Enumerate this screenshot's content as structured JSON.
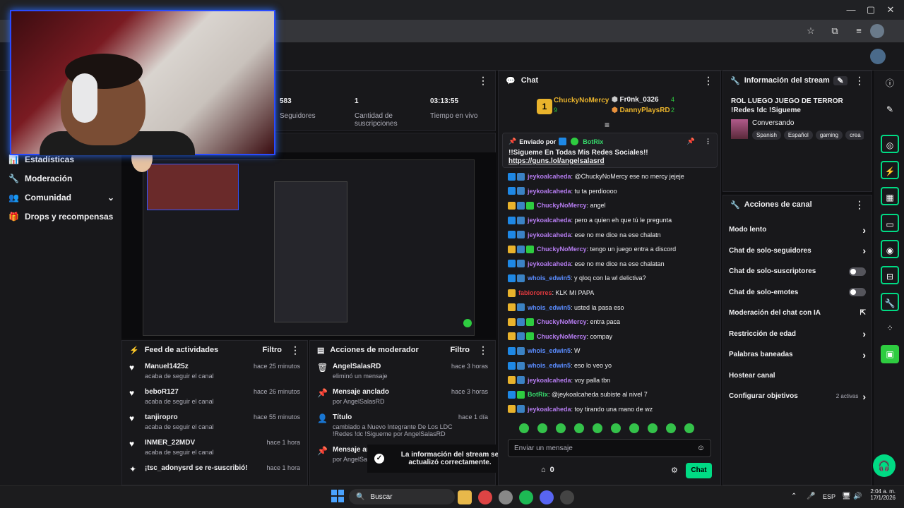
{
  "browser": {
    "extension_icons": [
      "star-icon",
      "puzzle-icon",
      "media-icon",
      "avatar"
    ]
  },
  "sidebar": {
    "items": [
      {
        "label": "Estadísticas"
      },
      {
        "label": "Moderación"
      },
      {
        "label": "Comunidad"
      },
      {
        "label": "Drops y recompensas"
      }
    ]
  },
  "stats": [
    {
      "value": "583",
      "label": "Seguidores"
    },
    {
      "value": "1",
      "label": "Cantidad de suscripciones"
    },
    {
      "value": "03:13:55",
      "label": "Tiempo en vivo"
    }
  ],
  "feed": {
    "title": "Feed de actividades",
    "filter_label": "Filtro",
    "items": [
      {
        "name": "Manuel1425z",
        "sub": "acaba de seguir el canal",
        "time": "hace 25 minutos"
      },
      {
        "name": "beboR127",
        "sub": "acaba de seguir el canal",
        "time": "hace 26 minutos"
      },
      {
        "name": "tanjiropro",
        "sub": "acaba de seguir el canal",
        "time": "hace 55 minutos"
      },
      {
        "name": "INMER_22MDV",
        "sub": "acaba de seguir el canal",
        "time": "hace 1 hora"
      },
      {
        "name": "¡tsc_adonysrd se re-suscribió!",
        "sub": "",
        "time": "hace 1 hora"
      }
    ]
  },
  "modactions": {
    "title": "Acciones de moderador",
    "filter_label": "Filtro",
    "items": [
      {
        "name": "AngelSalasRD",
        "sub": "eliminó un mensaje",
        "time": "hace 3 horas"
      },
      {
        "name": "Mensaje anclado",
        "sub": "por AngelSalasRD",
        "time": "hace 3 horas"
      },
      {
        "name": "Título",
        "sub": "cambiado a Nuevo Integrante De Los LDC !Redes !dc !Sigueme por AngelSalasRD",
        "time": "hace 1 día"
      },
      {
        "name": "Mensaje an",
        "sub": "por AngelSal",
        "time": ""
      }
    ]
  },
  "toast": {
    "text": "La información del stream se actualizó correctamente."
  },
  "chat": {
    "title": "Chat",
    "leaderboard": [
      {
        "name": "ChuckyNoMercy",
        "count": "9"
      },
      {
        "name": "Fr0nk_0326",
        "count": "4"
      },
      {
        "name": "DannyPlaysRD",
        "count": "2"
      }
    ],
    "pinned": {
      "sent_by_label": "Enviado por",
      "sender": "BotRix",
      "message": "!!Sigueme En Todas Mis Redes Sociales!!",
      "link": "https://guns.lol/angelsalasrd"
    },
    "messages": [
      {
        "user": "jeykoalcaheda",
        "color": "#b57cf0",
        "text": ": @ChuckyNoMercy ese no mercy jejeje",
        "badges": [
          "arrow",
          "grid"
        ]
      },
      {
        "user": "jeykoalcaheda",
        "color": "#b57cf0",
        "text": ": tu ta perdioooo",
        "badges": [
          "arrow",
          "grid"
        ]
      },
      {
        "user": "ChuckyNoMercy",
        "color": "#b57cf0",
        "text": ": angel",
        "badges": [
          "crown",
          "grid",
          "green"
        ]
      },
      {
        "user": "jeykoalcaheda",
        "color": "#b57cf0",
        "text": ": pero a quien eh que tú le pregunta",
        "badges": [
          "arrow",
          "grid"
        ]
      },
      {
        "user": "jeykoalcaheda",
        "color": "#b57cf0",
        "text": ": ese no me dice na ese chalatn",
        "badges": [
          "arrow",
          "grid"
        ]
      },
      {
        "user": "ChuckyNoMercy",
        "color": "#b57cf0",
        "text": ": tengo un juego entra a discord",
        "badges": [
          "crown",
          "grid",
          "green"
        ]
      },
      {
        "user": "jeykoalcaheda",
        "color": "#b57cf0",
        "text": ": ese no me dice na ese chalatan",
        "badges": [
          "arrow",
          "grid"
        ]
      },
      {
        "user": "whois_edwin5",
        "color": "#5a8cff",
        "text": ": y qloq con la wl delictiva?",
        "badges": [
          "arrow",
          "grid"
        ]
      },
      {
        "user": "fabiororres",
        "color": "#e0393e",
        "text": ": KLK MI PAPA",
        "badges": [
          "crown"
        ]
      },
      {
        "user": "whois_edwin5",
        "color": "#5a8cff",
        "text": ": usted la pasa eso",
        "badges": [
          "crown",
          "grid"
        ]
      },
      {
        "user": "ChuckyNoMercy",
        "color": "#b57cf0",
        "text": ": entra paca",
        "badges": [
          "crown",
          "grid",
          "green"
        ]
      },
      {
        "user": "ChuckyNoMercy",
        "color": "#b57cf0",
        "text": ": compay",
        "badges": [
          "crown",
          "grid",
          "green"
        ]
      },
      {
        "user": "whois_edwin5",
        "color": "#5a8cff",
        "text": ": W",
        "badges": [
          "arrow",
          "grid"
        ]
      },
      {
        "user": "whois_edwin5",
        "color": "#5a8cff",
        "text": ": eso lo veo yo",
        "badges": [
          "arrow",
          "grid"
        ]
      },
      {
        "user": "jeykoalcaheda",
        "color": "#b57cf0",
        "text": ": voy palla tbn",
        "badges": [
          "crown",
          "grid"
        ]
      },
      {
        "user": "BotRix",
        "color": "#36d96b",
        "text": ": @jeykoalcaheda subiste al nivel 7",
        "badges": [
          "arrow",
          "green"
        ]
      },
      {
        "user": "jeykoalcaheda",
        "color": "#b57cf0",
        "text": ": toy tirando una mano de wz",
        "badges": [
          "crown",
          "grid"
        ]
      }
    ],
    "input_placeholder": "Enviar un mensaje",
    "points": "0",
    "send_label": "Chat"
  },
  "stream_info": {
    "title": "Información del stream",
    "stream_title": "ROL LUEGO JUEGO DE TERROR !Redes !dc !Sigueme",
    "category": "Conversando",
    "tags": [
      "Spanish",
      "Español",
      "gaming",
      "crea"
    ]
  },
  "channel_actions": {
    "title": "Acciones de canal",
    "items": [
      {
        "label": "Modo lento",
        "control": "chevron"
      },
      {
        "label": "Chat de solo-seguidores",
        "control": "chevron"
      },
      {
        "label": "Chat de solo-suscriptores",
        "control": "toggle"
      },
      {
        "label": "Chat de solo-emotes",
        "control": "toggle"
      },
      {
        "label": "Moderación del chat con IA",
        "control": "external"
      },
      {
        "label": "Restricción de edad",
        "control": "chevron"
      },
      {
        "label": "Palabras baneadas",
        "control": "chevron"
      },
      {
        "label": "Hostear canal",
        "control": "none"
      },
      {
        "label": "Configurar objetivos",
        "control": "chevron",
        "extra": "2 activas"
      }
    ]
  },
  "taskbar": {
    "search_label": "Buscar",
    "lang": "ESP",
    "time": "2:04 a. m.",
    "date": "17/1/2026"
  },
  "colors": {
    "accent_green": "#00db84",
    "twitch_purple": "#9147ff",
    "bg": "#0e0e10",
    "panel": "#18181b"
  }
}
